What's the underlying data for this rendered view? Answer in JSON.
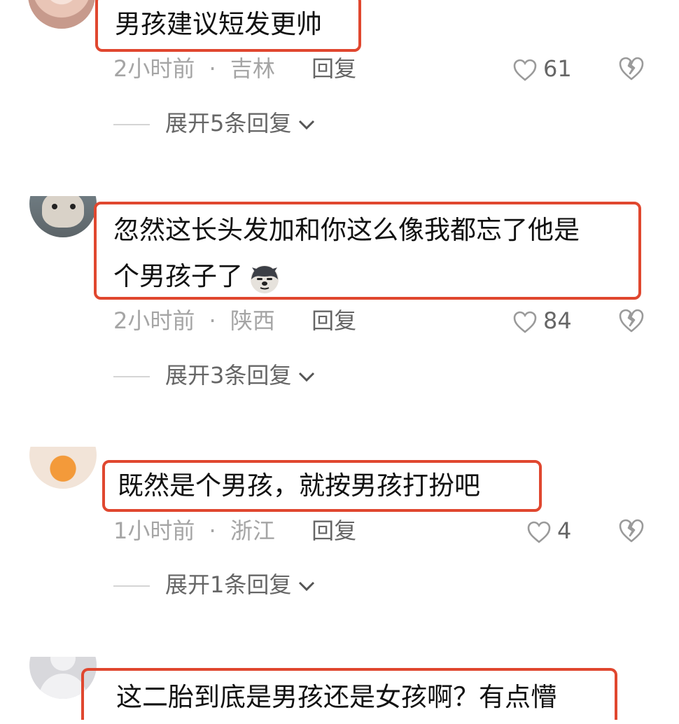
{
  "comments": [
    {
      "text_lines": [
        "男孩建议短发更帅"
      ],
      "time": "2小时前",
      "location": "吉林",
      "reply_label": "回复",
      "likes": "61",
      "expand_label": "展开5条回复"
    },
    {
      "text_lines": [
        "忽然这长头发加和你这么像我都忘了他是",
        "个男孩子了"
      ],
      "emoji": "dog-emoji",
      "time": "2小时前",
      "location": "陕西",
      "reply_label": "回复",
      "likes": "84",
      "expand_label": "展开3条回复"
    },
    {
      "text_lines": [
        "既然是个男孩，就按男孩打扮吧"
      ],
      "time": "1小时前",
      "location": "浙江",
      "reply_label": "回复",
      "likes": "4",
      "expand_label": "展开1条回复"
    },
    {
      "text_lines": [
        "这二胎到底是男孩还是女孩啊？有点懵"
      ]
    }
  ],
  "separator": "·",
  "colors": {
    "highlight_border": "#e0472f",
    "meta_gray": "#a5a5a5"
  }
}
